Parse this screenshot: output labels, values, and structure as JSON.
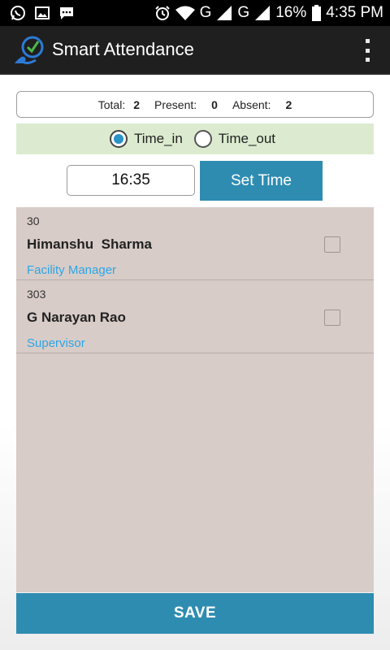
{
  "status_bar": {
    "battery": "16%",
    "time": "4:35 PM",
    "network_1": "G",
    "network_2": "G",
    "icons_left": [
      "whatsapp-icon",
      "image-icon",
      "message-icon"
    ],
    "icons_right": [
      "alarm-icon",
      "wifi-icon",
      "signal-icon",
      "signal-icon",
      "battery-icon"
    ]
  },
  "app_bar": {
    "title": "Smart Attendance",
    "logo_icon": "smart-attendance-logo",
    "menu_icon": "overflow-menu-icon"
  },
  "summary": {
    "total_label": "Total:",
    "total_value": "2",
    "present_label": "Present:",
    "present_value": "0",
    "absent_label": "Absent:",
    "absent_value": "2"
  },
  "mode": {
    "options": [
      "Time_in",
      "Time_out"
    ],
    "selected": "Time_in"
  },
  "time": {
    "value": "16:35",
    "set_button": "Set Time"
  },
  "employees": [
    {
      "id": "30",
      "name": "Himanshu  Sharma",
      "role": "Facility Manager",
      "checked": false
    },
    {
      "id": "303",
      "name": "G Narayan Rao",
      "role": "Supervisor",
      "checked": false
    }
  ],
  "save_button": "SAVE",
  "colors": {
    "accent": "#2e8cb1",
    "role_text": "#2ba6e6",
    "radio_row_bg": "#dcebcf",
    "list_bg": "#d8ccc8",
    "app_bar_bg": "#1f1f1f"
  }
}
